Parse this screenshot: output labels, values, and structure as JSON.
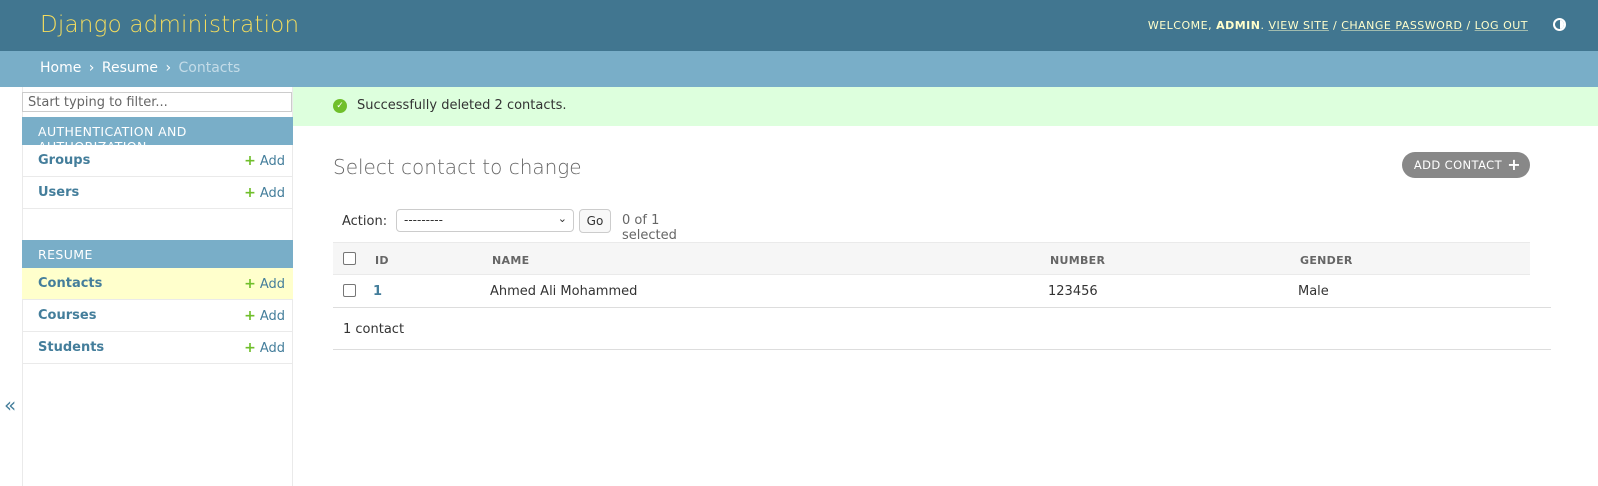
{
  "header": {
    "branding": "Django administration",
    "welcome": "WELCOME,",
    "username": "ADMIN",
    "view_site": "VIEW SITE",
    "change_password": "CHANGE PASSWORD",
    "log_out": "LOG OUT",
    "sep": "/"
  },
  "breadcrumbs": {
    "home": "Home",
    "app": "Resume",
    "current": "Contacts",
    "sep": "›"
  },
  "sidebar": {
    "filter_placeholder": "Start typing to filter...",
    "collapse_glyph": "«",
    "modules": [
      {
        "caption": "Authentication and Authorization",
        "items": [
          {
            "label": "Groups",
            "add": "Add"
          },
          {
            "label": "Users",
            "add": "Add"
          }
        ]
      },
      {
        "caption": "Resume",
        "items": [
          {
            "label": "Contacts",
            "add": "Add",
            "current": true
          },
          {
            "label": "Courses",
            "add": "Add"
          },
          {
            "label": "Students",
            "add": "Add"
          }
        ]
      }
    ]
  },
  "message": {
    "text": "Successfully deleted 2 contacts.",
    "icon": "check-icon"
  },
  "main": {
    "title": "Select contact to change",
    "add_button": "ADD CONTACT",
    "action_label": "Action:",
    "action_value": "---------",
    "go_label": "Go",
    "selected_count": "0 of 1 selected",
    "columns": [
      "ID",
      "NAME",
      "NUMBER",
      "GENDER"
    ],
    "rows": [
      {
        "id": "1",
        "name": "Ahmed Ali Mohammed",
        "number": "123456",
        "gender": "Male"
      }
    ],
    "paginator": "1 contact"
  },
  "colors": {
    "header_bg": "#417690",
    "branding": "#f5dd5d",
    "breadcrumbs_bg": "#79aec8",
    "success_bg": "#ddffdd",
    "current_row": "#ffffcc",
    "link": "#447e9b",
    "add_green": "#70bf2b"
  }
}
